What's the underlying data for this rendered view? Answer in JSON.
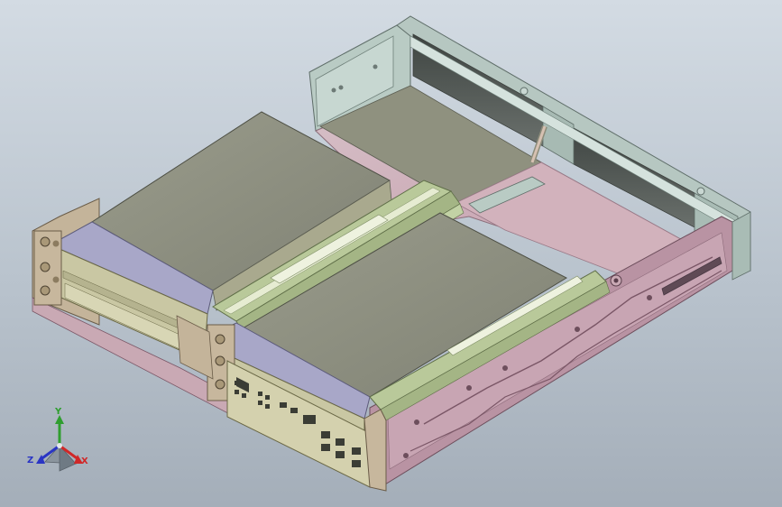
{
  "viewport": {
    "background": "#c0c9d2",
    "model": "chassis-assembly",
    "colors": {
      "frame": "#b7c8c2",
      "frame_dark": "#7f928c",
      "floor": "#c9a9b4",
      "side_plate": "#b58fa0",
      "drive_top": "#8d8f7f",
      "drive_side": "#c9c7a3",
      "drive_face": "#a9a8c9",
      "rail": "#b9c99a",
      "rail_light": "#e6ecd2",
      "io_panel": "#c9c7a3",
      "wall_dark": "#4d524f"
    }
  },
  "triad": {
    "axis_y": "Y",
    "axis_x": "X",
    "axis_z": "Z",
    "color_y": "#2f9e2f",
    "color_x": "#d02828",
    "color_z": "#2a35c4"
  }
}
